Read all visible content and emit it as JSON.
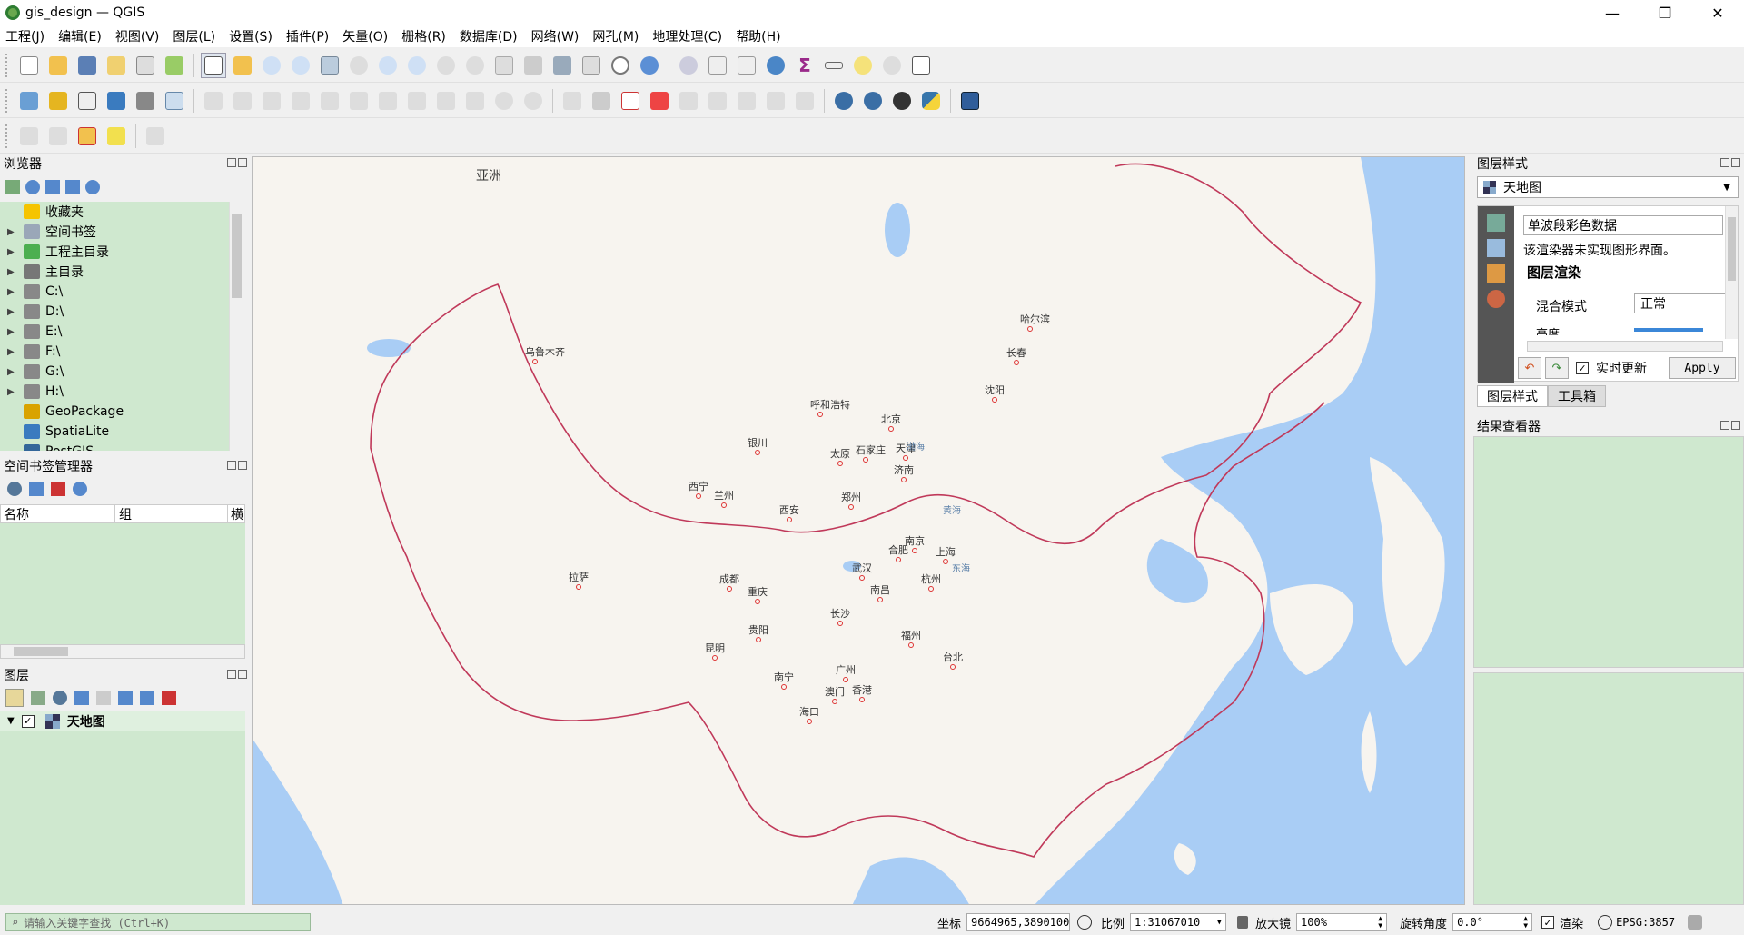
{
  "window": {
    "title": "gis_design — QGIS",
    "min": "—",
    "max": "❐",
    "close": "✕"
  },
  "menu": [
    "工程(J)",
    "编辑(E)",
    "视图(V)",
    "图层(L)",
    "设置(S)",
    "插件(P)",
    "矢量(O)",
    "栅格(R)",
    "数据库(D)",
    "网络(W)",
    "网孔(M)",
    "地理处理(C)",
    "帮助(H)"
  ],
  "browser": {
    "title": "浏览器",
    "items": [
      {
        "label": "收藏夹",
        "icon": "star-icon",
        "color": "#f5c400",
        "arrow": ""
      },
      {
        "label": "空间书签",
        "icon": "bookmark-icon",
        "color": "#9aa7b8",
        "arrow": "▶"
      },
      {
        "label": "工程主目录",
        "icon": "project-home-icon",
        "color": "#4caf50",
        "arrow": "▶"
      },
      {
        "label": "主目录",
        "icon": "home-icon",
        "color": "#777",
        "arrow": "▶"
      },
      {
        "label": "C:\\",
        "icon": "folder-icon",
        "color": "#888",
        "arrow": "▶"
      },
      {
        "label": "D:\\",
        "icon": "folder-icon",
        "color": "#888",
        "arrow": "▶"
      },
      {
        "label": "E:\\",
        "icon": "folder-icon",
        "color": "#888",
        "arrow": "▶"
      },
      {
        "label": "F:\\",
        "icon": "folder-icon",
        "color": "#888",
        "arrow": "▶"
      },
      {
        "label": "G:\\",
        "icon": "folder-icon",
        "color": "#888",
        "arrow": "▶"
      },
      {
        "label": "H:\\",
        "icon": "folder-icon",
        "color": "#888",
        "arrow": "▶"
      },
      {
        "label": "GeoPackage",
        "icon": "geopackage-icon",
        "color": "#d9a300",
        "arrow": ""
      },
      {
        "label": "SpatiaLite",
        "icon": "spatialite-icon",
        "color": "#3a7bbf",
        "arrow": ""
      },
      {
        "label": "PostGIS",
        "icon": "postgis-icon",
        "color": "#336699",
        "arrow": ""
      }
    ]
  },
  "bookmarks": {
    "title": "空间书签管理器",
    "col_name": "名称",
    "col_group": "组",
    "col_extra": "横"
  },
  "layers": {
    "title": "图层",
    "items": [
      {
        "label": "天地图",
        "checked": "✓"
      }
    ]
  },
  "layer_style": {
    "title": "图层样式",
    "layer": "天地图",
    "renderer": "单波段彩色数据",
    "note": "该渲染器未实现图形界面。",
    "section": "图层渲染",
    "blend_label": "混合模式",
    "blend_value": "正常",
    "brightness_label": "亮度",
    "live_update": "实时更新",
    "apply": "Apply",
    "tab_style": "图层样式",
    "tab_toolbox": "工具箱"
  },
  "results": {
    "title": "结果查看器"
  },
  "map": {
    "continent": "亚洲",
    "cities": [
      "哈尔滨",
      "长春",
      "沈阳",
      "乌鲁木齐",
      "呼和浩特",
      "北京",
      "天津",
      "银川",
      "太原",
      "石家庄",
      "西宁",
      "兰州",
      "济南",
      "西安",
      "郑州",
      "合肥",
      "南京",
      "上海",
      "武汉",
      "拉萨",
      "成都",
      "杭州",
      "重庆",
      "南昌",
      "长沙",
      "贵阳",
      "福州",
      "昆明",
      "台北",
      "广州",
      "南宁",
      "澳门",
      "香港",
      "海口"
    ],
    "seas": [
      "渤海",
      "黄海",
      "东海"
    ]
  },
  "status": {
    "search_placeholder": "请输入关键字查找 (Ctrl+K)",
    "coord_label": "坐标",
    "coord_value": "9664965,3890100",
    "scale_label": "比例",
    "scale_value": "1:31067010",
    "magnifier_label": "放大镜",
    "magnifier_value": "100%",
    "rotation_label": "旋转角度",
    "rotation_value": "0.0°",
    "render_label": "渲染",
    "crs": "EPSG:3857"
  },
  "colors": {
    "panel_green": "#cfe8cf",
    "border_red": "#c0395a",
    "sea": "#a9cdf5",
    "land": "#f7f4ef"
  }
}
